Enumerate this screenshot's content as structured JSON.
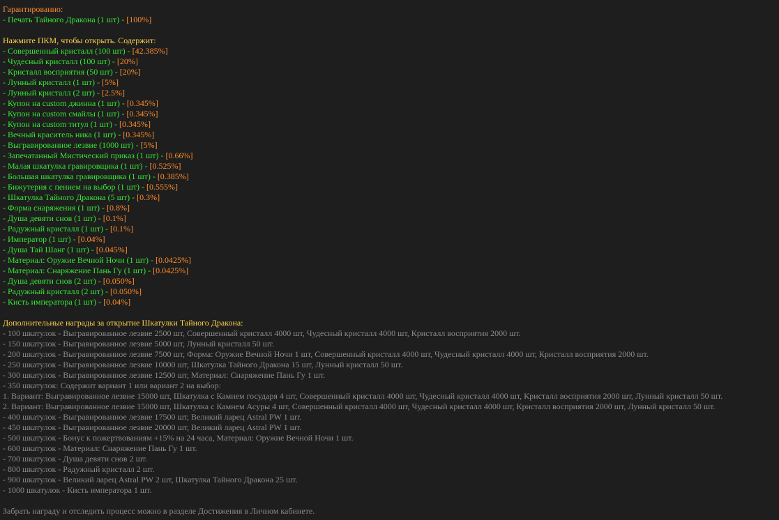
{
  "guaranteed": {
    "title": "Гарантированно:",
    "items": [
      {
        "name": "- Печать Тайного Дракона (1 шт) - ",
        "chance": "[100%]"
      }
    ]
  },
  "contents": {
    "title": "Нажмите ПКМ, чтобы открыть. Содержит:",
    "items": [
      {
        "name": "- Совершенный кристалл (100 шт) - ",
        "chance": "[42.385%]"
      },
      {
        "name": "- Чудесный кристалл (100 шт) - ",
        "chance": "[20%]"
      },
      {
        "name": "- Кристалл восприятия (50 шт) - ",
        "chance": "[20%]"
      },
      {
        "name": "- Лунный кристалл (1 шт) - ",
        "chance": "[5%]"
      },
      {
        "name": "- Лунный кристалл (2 шт) - ",
        "chance": "[2.5%]"
      },
      {
        "name": "- Купон на custom джинна (1 шт) - ",
        "chance": "[0.345%]"
      },
      {
        "name": "- Купон на custom смайлы  (1 шт) - ",
        "chance": "[0.345%]"
      },
      {
        "name": "- Купон на custom титул  (1 шт) - ",
        "chance": "[0.345%]"
      },
      {
        "name": "- Вечный краситель ника (1 шт) - ",
        "chance": "[0.345%]"
      },
      {
        "name": "- Выгравированное лезвие (1000 шт) - ",
        "chance": "[5%]"
      },
      {
        "name": "- Запечатанный Мистический приказ (1 шт) - ",
        "chance": "[0.66%]"
      },
      {
        "name": "- Малая шкатулка гравировщика (1 шт) - ",
        "chance": "[0.525%]"
      },
      {
        "name": "- Большая шкатулка гравировщика (1 шт) - ",
        "chance": "[0.385%]"
      },
      {
        "name": "- Бижутерия с пением на выбор (1 шт) - ",
        "chance": "[0.555%]"
      },
      {
        "name": "- Шкатулка Тайного Дракона (5 шт) - ",
        "chance": "[0.3%]"
      },
      {
        "name": "- Форма снаряжения (1 шт) - ",
        "chance": "[0.8%]"
      },
      {
        "name": "- Душа девяти снов (1 шт) - ",
        "chance": "[0.1%]"
      },
      {
        "name": "- Радужный кристалл (1 шт) - ",
        "chance": "[0.1%]"
      },
      {
        "name": "- Император (1 шт) - ",
        "chance": "[0.04%]"
      },
      {
        "name": "- Душа Тай Шанг (1 шт) - ",
        "chance": "[0.045%]"
      },
      {
        "name": "- Материал: Оружие Вечной Ночи (1 шт) - ",
        "chance": "[0.0425%]"
      },
      {
        "name": "- Материал: Снаряжение Пань Гу (1 шт) - ",
        "chance": "[0.0425%]"
      },
      {
        "name": "- Душа девяти снов (2 шт) - ",
        "chance": "[0.050%]"
      },
      {
        "name": "- Радужный кристалл (2 шт) - ",
        "chance": "[0.050%]"
      },
      {
        "name": "- Кисть императора (1 шт) - ",
        "chance": "[0.04%]"
      }
    ]
  },
  "bonus": {
    "title": "Дополнительные награды за открытие Шкатулки Тайного Дракона:",
    "lines": [
      "- 100 шкатулок - Выгравированное лезвие 2500 шт, Совершенный кристалл 4000 шт, Чудесный кристалл 4000 шт, Кристалл восприятия 2000 шт.",
      "- 150 шкатулок - Выгравированное лезвие 5000 шт, Лунный кристалл 50 шт.",
      "- 200 шкатулок - Выгравированное лезвие 7500 шт, Форма: Оружие Вечной Ночи 1 шт, Совершенный кристалл 4000 шт, Чудесный кристалл 4000 шт, Кристалл восприятия 2000 шт.",
      "- 250 шкатулок - Выгравированное лезвие 10000 шт, Шкатулка Тайного Дракона 15 шт, Лунный кристалл 50 шт.",
      "- 300 шкатулок - Выгравированное лезвие 12500 шт, Материал: Снаряжение Пань Гу 1 шт.",
      "- 350 шкатулок: Содержит вариант 1 или вариант 2 на выбор:",
      "1. Вариант: Выгравированное лезвие 15000 шт, Шкатулка с Камнем государя 4 шт, Совершенный кристалл 4000 шт, Чудесный кристалл 4000 шт, Кристалл восприятия 2000 шт, Лунный кристалл 50 шт.",
      "2. Вариант: Выгравированное лезвие 15000 шт, Шкатулка с Камнем Асуры 4 шт, Совершенный кристалл 4000 шт, Чудесный кристалл 4000 шт, Кристалл восприятия 2000 шт, Лунный кристалл 50 шт.",
      "- 400 шкатулок - Выгравированное лезвие 17500 шт, Великий ларец Astral PW 1 шт.",
      "- 450 шкатулок - Выгравированное лезвие 20000 шт, Великий ларец Astral PW 1 шт.",
      "- 500 шкатулок - Бонус к пожертвованиям +15% на 24 часа, Материал: Оружие Вечной Ночи 1 шт.",
      "- 600 шкатулок - Материал: Снаряжение Пань Гу 1 шт.",
      "- 700 шкатулок - Душа девяти снов 2 шт.",
      "- 800 шкатулок - Радужный кристалл 2 шт.",
      "- 900 шкатулок - Великий ларец Astral PW 2 шт, Шкатулка Тайного Дракона 25 шт.",
      "- 1000 шкатулок - Кисть императора 1 шт."
    ]
  },
  "footer": "Забрать награду и отследить процесс можно в разделе Достижения в Личном кабинете.",
  "colors": {
    "background": "#1e1e1e",
    "header_orange": "#ff8c2a",
    "header_yellow": "#ffd24a",
    "item_green": "#34e834",
    "chance_orange": "#ff8c2a",
    "muted_gray": "#8a8a8a"
  }
}
